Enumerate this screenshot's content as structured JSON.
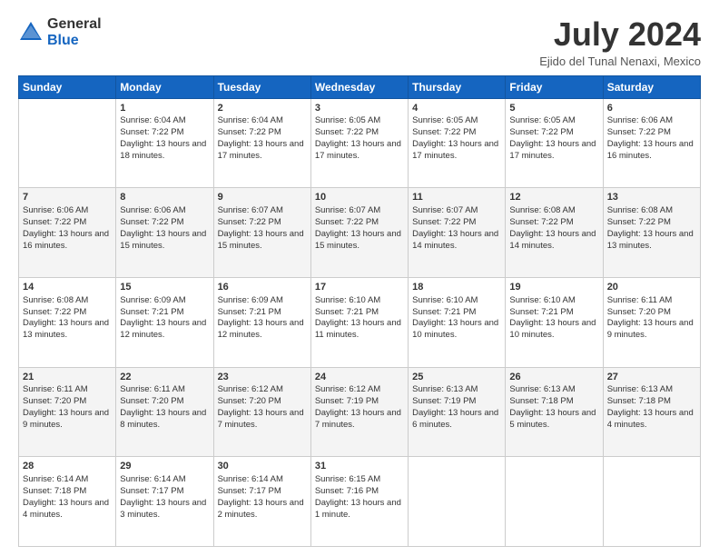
{
  "logo": {
    "general": "General",
    "blue": "Blue"
  },
  "title": "July 2024",
  "location": "Ejido del Tunal Nenaxi, Mexico",
  "days": [
    "Sunday",
    "Monday",
    "Tuesday",
    "Wednesday",
    "Thursday",
    "Friday",
    "Saturday"
  ],
  "weeks": [
    [
      {
        "day": null,
        "data": null
      },
      {
        "day": "1",
        "sunrise": "Sunrise: 6:04 AM",
        "sunset": "Sunset: 7:22 PM",
        "daylight": "Daylight: 13 hours and 18 minutes."
      },
      {
        "day": "2",
        "sunrise": "Sunrise: 6:04 AM",
        "sunset": "Sunset: 7:22 PM",
        "daylight": "Daylight: 13 hours and 17 minutes."
      },
      {
        "day": "3",
        "sunrise": "Sunrise: 6:05 AM",
        "sunset": "Sunset: 7:22 PM",
        "daylight": "Daylight: 13 hours and 17 minutes."
      },
      {
        "day": "4",
        "sunrise": "Sunrise: 6:05 AM",
        "sunset": "Sunset: 7:22 PM",
        "daylight": "Daylight: 13 hours and 17 minutes."
      },
      {
        "day": "5",
        "sunrise": "Sunrise: 6:05 AM",
        "sunset": "Sunset: 7:22 PM",
        "daylight": "Daylight: 13 hours and 17 minutes."
      },
      {
        "day": "6",
        "sunrise": "Sunrise: 6:06 AM",
        "sunset": "Sunset: 7:22 PM",
        "daylight": "Daylight: 13 hours and 16 minutes."
      }
    ],
    [
      {
        "day": "7",
        "sunrise": "Sunrise: 6:06 AM",
        "sunset": "Sunset: 7:22 PM",
        "daylight": "Daylight: 13 hours and 16 minutes."
      },
      {
        "day": "8",
        "sunrise": "Sunrise: 6:06 AM",
        "sunset": "Sunset: 7:22 PM",
        "daylight": "Daylight: 13 hours and 15 minutes."
      },
      {
        "day": "9",
        "sunrise": "Sunrise: 6:07 AM",
        "sunset": "Sunset: 7:22 PM",
        "daylight": "Daylight: 13 hours and 15 minutes."
      },
      {
        "day": "10",
        "sunrise": "Sunrise: 6:07 AM",
        "sunset": "Sunset: 7:22 PM",
        "daylight": "Daylight: 13 hours and 15 minutes."
      },
      {
        "day": "11",
        "sunrise": "Sunrise: 6:07 AM",
        "sunset": "Sunset: 7:22 PM",
        "daylight": "Daylight: 13 hours and 14 minutes."
      },
      {
        "day": "12",
        "sunrise": "Sunrise: 6:08 AM",
        "sunset": "Sunset: 7:22 PM",
        "daylight": "Daylight: 13 hours and 14 minutes."
      },
      {
        "day": "13",
        "sunrise": "Sunrise: 6:08 AM",
        "sunset": "Sunset: 7:22 PM",
        "daylight": "Daylight: 13 hours and 13 minutes."
      }
    ],
    [
      {
        "day": "14",
        "sunrise": "Sunrise: 6:08 AM",
        "sunset": "Sunset: 7:22 PM",
        "daylight": "Daylight: 13 hours and 13 minutes."
      },
      {
        "day": "15",
        "sunrise": "Sunrise: 6:09 AM",
        "sunset": "Sunset: 7:21 PM",
        "daylight": "Daylight: 13 hours and 12 minutes."
      },
      {
        "day": "16",
        "sunrise": "Sunrise: 6:09 AM",
        "sunset": "Sunset: 7:21 PM",
        "daylight": "Daylight: 13 hours and 12 minutes."
      },
      {
        "day": "17",
        "sunrise": "Sunrise: 6:10 AM",
        "sunset": "Sunset: 7:21 PM",
        "daylight": "Daylight: 13 hours and 11 minutes."
      },
      {
        "day": "18",
        "sunrise": "Sunrise: 6:10 AM",
        "sunset": "Sunset: 7:21 PM",
        "daylight": "Daylight: 13 hours and 10 minutes."
      },
      {
        "day": "19",
        "sunrise": "Sunrise: 6:10 AM",
        "sunset": "Sunset: 7:21 PM",
        "daylight": "Daylight: 13 hours and 10 minutes."
      },
      {
        "day": "20",
        "sunrise": "Sunrise: 6:11 AM",
        "sunset": "Sunset: 7:20 PM",
        "daylight": "Daylight: 13 hours and 9 minutes."
      }
    ],
    [
      {
        "day": "21",
        "sunrise": "Sunrise: 6:11 AM",
        "sunset": "Sunset: 7:20 PM",
        "daylight": "Daylight: 13 hours and 9 minutes."
      },
      {
        "day": "22",
        "sunrise": "Sunrise: 6:11 AM",
        "sunset": "Sunset: 7:20 PM",
        "daylight": "Daylight: 13 hours and 8 minutes."
      },
      {
        "day": "23",
        "sunrise": "Sunrise: 6:12 AM",
        "sunset": "Sunset: 7:20 PM",
        "daylight": "Daylight: 13 hours and 7 minutes."
      },
      {
        "day": "24",
        "sunrise": "Sunrise: 6:12 AM",
        "sunset": "Sunset: 7:19 PM",
        "daylight": "Daylight: 13 hours and 7 minutes."
      },
      {
        "day": "25",
        "sunrise": "Sunrise: 6:13 AM",
        "sunset": "Sunset: 7:19 PM",
        "daylight": "Daylight: 13 hours and 6 minutes."
      },
      {
        "day": "26",
        "sunrise": "Sunrise: 6:13 AM",
        "sunset": "Sunset: 7:18 PM",
        "daylight": "Daylight: 13 hours and 5 minutes."
      },
      {
        "day": "27",
        "sunrise": "Sunrise: 6:13 AM",
        "sunset": "Sunset: 7:18 PM",
        "daylight": "Daylight: 13 hours and 4 minutes."
      }
    ],
    [
      {
        "day": "28",
        "sunrise": "Sunrise: 6:14 AM",
        "sunset": "Sunset: 7:18 PM",
        "daylight": "Daylight: 13 hours and 4 minutes."
      },
      {
        "day": "29",
        "sunrise": "Sunrise: 6:14 AM",
        "sunset": "Sunset: 7:17 PM",
        "daylight": "Daylight: 13 hours and 3 minutes."
      },
      {
        "day": "30",
        "sunrise": "Sunrise: 6:14 AM",
        "sunset": "Sunset: 7:17 PM",
        "daylight": "Daylight: 13 hours and 2 minutes."
      },
      {
        "day": "31",
        "sunrise": "Sunrise: 6:15 AM",
        "sunset": "Sunset: 7:16 PM",
        "daylight": "Daylight: 13 hours and 1 minute."
      },
      {
        "day": null,
        "data": null
      },
      {
        "day": null,
        "data": null
      },
      {
        "day": null,
        "data": null
      }
    ]
  ]
}
